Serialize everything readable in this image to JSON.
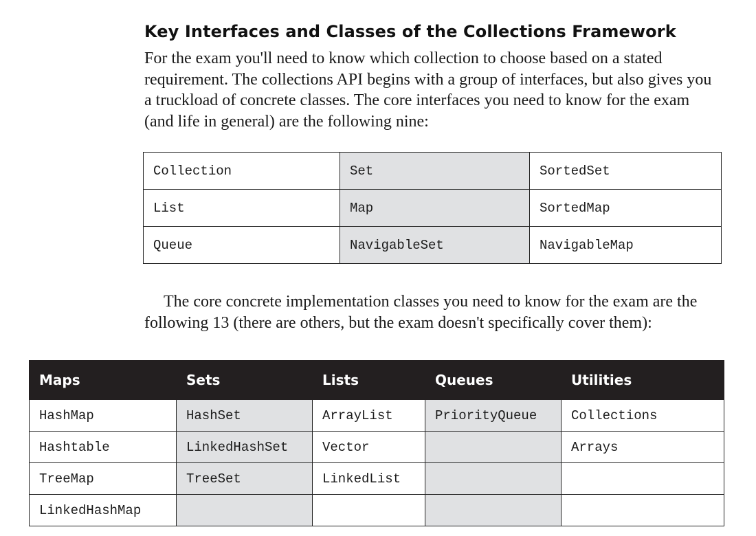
{
  "heading": "Key Interfaces and Classes of the Collections Framework",
  "para1": "For the exam you'll need to know which collection to choose based on a stated requirement. The collections API begins with a group of interfaces, but also gives you a truckload of concrete classes. The core interfaces you need to know for the exam (and life in general) are the following nine:",
  "interfaces_table": {
    "rows": [
      [
        "Collection",
        "Set",
        "SortedSet"
      ],
      [
        "List",
        "Map",
        "SortedMap"
      ],
      [
        "Queue",
        "NavigableSet",
        "NavigableMap"
      ]
    ]
  },
  "para2": "The core concrete implementation classes you need to know for the exam are the following 13 (there are others, but the exam doesn't specifically cover them):",
  "classes_table": {
    "headers": [
      "Maps",
      "Sets",
      "Lists",
      "Queues",
      "Utilities"
    ],
    "rows": [
      [
        "HashMap",
        "HashSet",
        "ArrayList",
        "PriorityQueue",
        "Collections"
      ],
      [
        "Hashtable",
        "LinkedHashSet",
        "Vector",
        "",
        "Arrays"
      ],
      [
        "TreeMap",
        "TreeSet",
        "LinkedList",
        "",
        ""
      ],
      [
        "LinkedHashMap",
        "",
        "",
        "",
        ""
      ]
    ]
  }
}
